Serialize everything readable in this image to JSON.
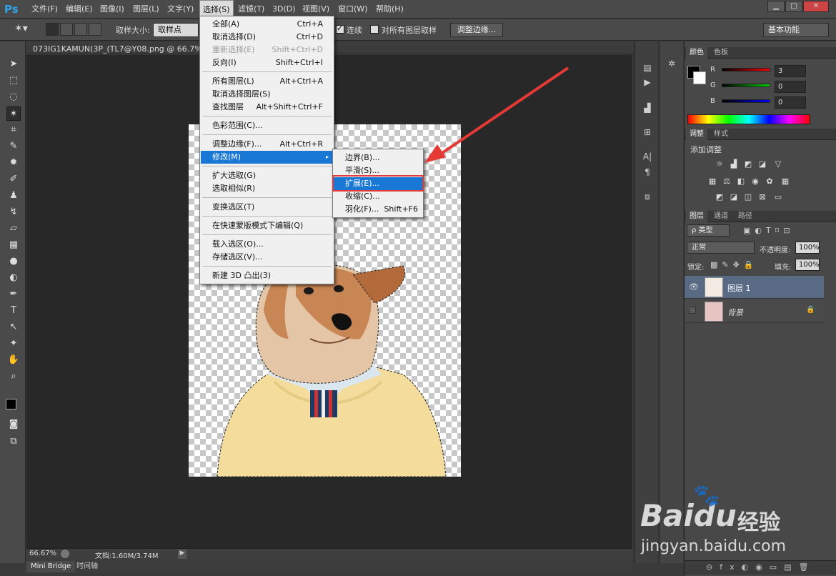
{
  "app": {
    "logo": "Ps"
  },
  "menubar": {
    "items": [
      "文件(F)",
      "编辑(E)",
      "图像(I)",
      "图层(L)",
      "文字(Y)",
      "选择(S)",
      "滤镜(T)",
      "3D(D)",
      "视图(V)",
      "窗口(W)",
      "帮助(H)"
    ],
    "window_buttons": [
      "▁",
      "□",
      "✕"
    ]
  },
  "options": {
    "sample_label": "取样大小:",
    "sample_value": "取样点",
    "contiguous": "连续",
    "all_layers": "对所有图层取样",
    "refine_edge": "调整边缘...",
    "workspace": "基本功能"
  },
  "document": {
    "tab_title": "073IG1KAMUN(3P_(TL7@Y08.png @ 66.7% (图层",
    "zoom": "66.67%",
    "doc_size": "文档:1.60M/3.74M"
  },
  "bottom_tabs": [
    "Mini Bridge",
    "时间轴"
  ],
  "select_menu": {
    "items": [
      {
        "label": "全部(A)",
        "shortcut": "Ctrl+A",
        "disabled": false
      },
      {
        "label": "取消选择(D)",
        "shortcut": "Ctrl+D",
        "disabled": false
      },
      {
        "label": "重新选择(E)",
        "shortcut": "Shift+Ctrl+D",
        "disabled": true
      },
      {
        "label": "反向(I)",
        "shortcut": "Shift+Ctrl+I",
        "disabled": false
      },
      {
        "label": "所有图层(L)",
        "shortcut": "Alt+Ctrl+A",
        "disabled": false
      },
      {
        "label": "取消选择图层(S)",
        "shortcut": "",
        "disabled": false
      },
      {
        "label": "查找图层",
        "shortcut": "Alt+Shift+Ctrl+F",
        "disabled": false
      },
      {
        "label": "色彩范围(C)...",
        "shortcut": "",
        "disabled": false
      },
      {
        "label": "调整边缘(F)...",
        "shortcut": "Alt+Ctrl+R",
        "disabled": false
      },
      {
        "label": "修改(M)",
        "shortcut": "▸",
        "disabled": false,
        "highlighted": true
      },
      {
        "label": "扩大选取(G)",
        "shortcut": "",
        "disabled": false
      },
      {
        "label": "选取相似(R)",
        "shortcut": "",
        "disabled": false
      },
      {
        "label": "变换选区(T)",
        "shortcut": "",
        "disabled": false
      },
      {
        "label": "在快速蒙版模式下编辑(Q)",
        "shortcut": "",
        "disabled": false
      },
      {
        "label": "载入选区(O)...",
        "shortcut": "",
        "disabled": false
      },
      {
        "label": "存储选区(V)...",
        "shortcut": "",
        "disabled": false
      },
      {
        "label": "新建 3D 凸出(3)",
        "shortcut": "",
        "disabled": false
      }
    ]
  },
  "modify_menu": {
    "items": [
      {
        "label": "边界(B)...",
        "shortcut": ""
      },
      {
        "label": "平滑(S)...",
        "shortcut": ""
      },
      {
        "label": "扩展(E)...",
        "shortcut": "",
        "highlighted": true
      },
      {
        "label": "收缩(C)...",
        "shortcut": ""
      },
      {
        "label": "羽化(F)...",
        "shortcut": "Shift+F6"
      }
    ]
  },
  "color_panel": {
    "tabs": [
      "颜色",
      "色板"
    ],
    "channels": [
      {
        "name": "R",
        "value": "3"
      },
      {
        "name": "G",
        "value": "0"
      },
      {
        "name": "B",
        "value": "0"
      }
    ]
  },
  "adjust_panel": {
    "tabs": [
      "调整",
      "样式"
    ],
    "title": "添加调整"
  },
  "layers_panel": {
    "tabs": [
      "图层",
      "通道",
      "路径"
    ],
    "filter": "ρ 类型",
    "blend_mode": "正常",
    "opacity_label": "不透明度:",
    "opacity": "100%",
    "lock_label": "锁定:",
    "fill_label": "填充:",
    "fill": "100%",
    "layers": [
      {
        "name": "图层 1",
        "visible": true,
        "selected": true
      },
      {
        "name": "背景",
        "visible": false,
        "selected": false,
        "locked": true
      }
    ]
  },
  "watermark": {
    "brand": "Bai",
    "brand2": "du",
    "brand3": "经验",
    "url": "jingyan.baidu.com"
  },
  "colors": {
    "accent": "#1978d6",
    "highlight_box": "#e53935",
    "arrow": "#e53935"
  }
}
